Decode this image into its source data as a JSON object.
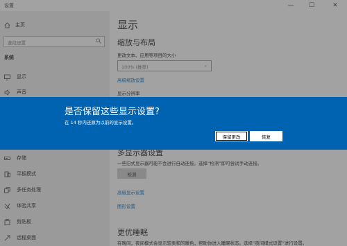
{
  "window": {
    "title": "设置",
    "min_glyph": "—",
    "max_glyph": "☐",
    "close_glyph": "✕"
  },
  "sidebar": {
    "home": "主页",
    "search_placeholder": "查找设置",
    "section": "系统",
    "items": [
      {
        "label": "显示",
        "icon": "monitor-icon"
      },
      {
        "label": "声音",
        "icon": "speaker-icon"
      },
      {
        "label": "存储",
        "icon": "storage-icon"
      },
      {
        "label": "平板模式",
        "icon": "tablet-mode-icon"
      },
      {
        "label": "多任务处理",
        "icon": "multitasking-icon"
      },
      {
        "label": "体验共享",
        "icon": "shared-experience-icon"
      },
      {
        "label": "剪贴板",
        "icon": "clipboard-icon"
      },
      {
        "label": "远程桌面",
        "icon": "remote-desktop-icon"
      }
    ]
  },
  "main": {
    "title": "显示",
    "scale_section": "缩放与布局",
    "text_size_label": "更改文本、应用等项目的大小",
    "text_size_value": "100% (推荐)",
    "advanced_scaling_link": "高级缩放设置",
    "resolution_label": "显示分辨率",
    "multi_display_section": "多显示器设置",
    "detect_hint": "一些旧式显示器可能不会进行自动连接。选择“检测”即可尝试手动连接。",
    "detect_button": "检测",
    "advanced_display_link": "高级显示设置",
    "graphics_link": "图形设置",
    "sleep_section": "更优睡眠",
    "sleep_text": "在晚间，夜间模式会显示较柔和的暖色，帮助你进入睡眠状态。选择“夜间模式设置”进行设置。"
  },
  "dialog": {
    "title": "是否保留这些显示设置?",
    "message": "在 14 秒内还原为以前的显示设置。",
    "keep_button": "保留更改",
    "revert_button": "恢复"
  },
  "colors": {
    "banner": "#0063b1",
    "link": "#0067b8",
    "sidebar_bg": "#efefef"
  }
}
